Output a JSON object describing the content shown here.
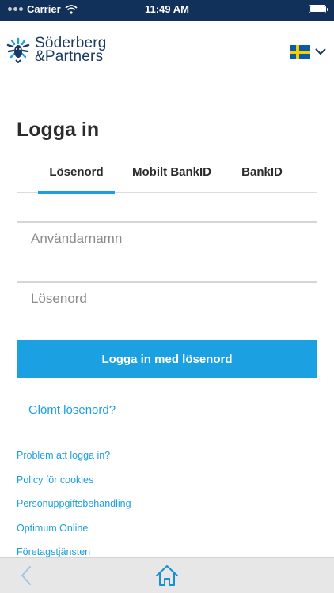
{
  "status_bar": {
    "carrier": "Carrier",
    "time": "11:49 AM"
  },
  "header": {
    "brand_line1": "Söderberg",
    "brand_line2": "&Partners",
    "language_flag": "sweden-flag-icon",
    "colors": {
      "brand": "#1b3a63",
      "status_bar": "#11305a"
    }
  },
  "login": {
    "title": "Logga in",
    "tabs": [
      {
        "label": "Lösenord",
        "active": true
      },
      {
        "label": "Mobilt BankID",
        "active": false
      },
      {
        "label": "BankID",
        "active": false
      }
    ],
    "username_placeholder": "Användarnamn",
    "username_value": "",
    "password_placeholder": "Lösenord",
    "password_value": "",
    "submit_label": "Logga in med lösenord",
    "forgot_label": "Glömt lösenord?",
    "accent_color": "#1ba1e2"
  },
  "links": [
    "Problem att logga in?",
    "Policy för cookies",
    "Personuppgiftsbehandling",
    "Optimum Online",
    "Företagstjänsten"
  ],
  "toolbar": {
    "back_icon": "chevron-left-icon",
    "home_icon": "home-icon"
  }
}
